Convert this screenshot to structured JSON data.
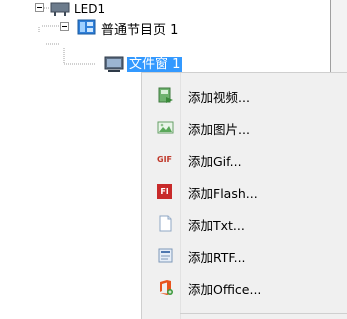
{
  "tree": {
    "root": {
      "label": "LED1",
      "icon": "display-screen-icon"
    },
    "program": {
      "label": "普通节目页 1",
      "icon": "program-page-icon"
    },
    "window": {
      "label": "文件窗 1",
      "icon": "window-icon"
    }
  },
  "context_menu": {
    "items": [
      {
        "label": "添加视频...",
        "icon": "video-icon"
      },
      {
        "label": "添加图片...",
        "icon": "picture-icon"
      },
      {
        "label": "添加Gif...",
        "icon": "gif-icon",
        "icon_text": "GIF"
      },
      {
        "label": "添加Flash...",
        "icon": "flash-icon",
        "icon_text": "Fl"
      },
      {
        "label": "添加Txt...",
        "icon": "txt-icon"
      },
      {
        "label": "添加RTF...",
        "icon": "rtf-icon"
      },
      {
        "label": "添加Office...",
        "icon": "office-icon"
      }
    ]
  },
  "colors": {
    "selection": "#3399ff",
    "menu_bg": "#f0f0f0"
  }
}
